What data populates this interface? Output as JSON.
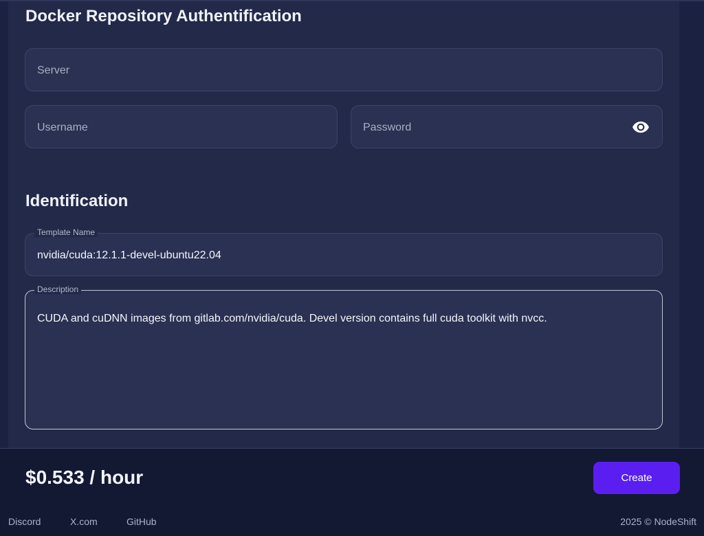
{
  "docker_auth": {
    "title": "Docker Repository Authentification",
    "server_placeholder": "Server",
    "username_placeholder": "Username",
    "password_placeholder": "Password"
  },
  "identification": {
    "title": "Identification",
    "template_name_label": "Template Name",
    "template_name_value": "nvidia/cuda:12.1.1-devel-ubuntu22.04",
    "description_label": "Description",
    "description_value": "CUDA and cuDNN images from gitlab.com/nvidia/cuda.  Devel version contains full cuda toolkit with nvcc."
  },
  "footer": {
    "price": "$0.533 / hour",
    "create_label": "Create",
    "links": [
      "Discord",
      "X.com",
      "GitHub"
    ],
    "copyright": "2025 © NodeShift"
  },
  "icons": {
    "password_toggle": "eye-icon"
  },
  "colors": {
    "accent": "#5a1ff0",
    "background": "#1b2140",
    "panel": "#222949",
    "footer": "#131833"
  }
}
